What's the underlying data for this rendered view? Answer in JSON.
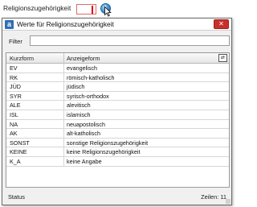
{
  "field": {
    "label": "Religionszugehörigkeit",
    "value": ""
  },
  "dialog": {
    "app_icon_letter": "a",
    "title": "Werte für Religionszugehörigkeit",
    "close_label": "✕",
    "filter_label": "Filter",
    "filter_value": "",
    "columns": [
      "Kurzform",
      "Anzeigeform"
    ],
    "rows": [
      {
        "kurzform": "EV",
        "anzeigeform": "evangelisch"
      },
      {
        "kurzform": "RK",
        "anzeigeform": "römisch-katholisch"
      },
      {
        "kurzform": "JÜD",
        "anzeigeform": "jüdisch"
      },
      {
        "kurzform": "SYR",
        "anzeigeform": "syrisch-orthodox"
      },
      {
        "kurzform": "ALE",
        "anzeigeform": "alevitisch"
      },
      {
        "kurzform": "ISL",
        "anzeigeform": "islamisch"
      },
      {
        "kurzform": "NA",
        "anzeigeform": "neuapostolisch"
      },
      {
        "kurzform": "AK",
        "anzeigeform": "alt-katholisch"
      },
      {
        "kurzform": "SONST",
        "anzeigeform": "sonstige Religionszugehörigkeit"
      },
      {
        "kurzform": "KEINE",
        "anzeigeform": "keine Religionszugehörigkeit"
      },
      {
        "kurzform": "K_A",
        "anzeigeform": "keine Angabe"
      }
    ],
    "status_label": "Status",
    "rows_count": "Zeilen: 11"
  },
  "colors": {
    "accent": "#2f6fb3",
    "close": "#c9302c",
    "required_marker": "#e00000"
  }
}
